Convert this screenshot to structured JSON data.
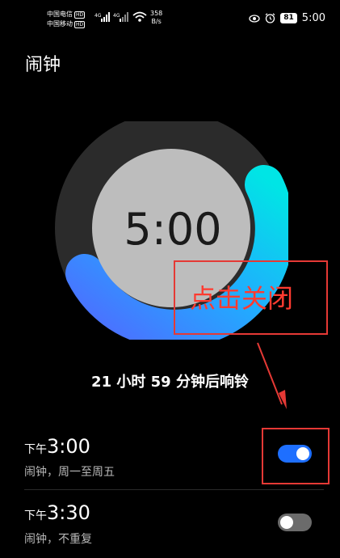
{
  "status_bar": {
    "carrier1": "中国电信",
    "carrier2": "中国移动",
    "hd_badge": "HD",
    "net_speed_value": "358",
    "net_speed_unit": "B/s",
    "battery": "81",
    "time": "5:00",
    "icons": [
      "eye-icon",
      "alarm-clock-icon",
      "wifi-icon",
      "signal-icon"
    ]
  },
  "page": {
    "title": "闹钟"
  },
  "dial": {
    "time": "5:00",
    "progress_arc_colors": [
      "#4f6bff",
      "#00d8e8"
    ]
  },
  "countdown": "21 小时 59 分钟后响铃",
  "alarms": [
    {
      "period": "下午",
      "time": "3:00",
      "subtitle": "闹钟，周一至周五",
      "enabled": true
    },
    {
      "period": "下午",
      "time": "3:30",
      "subtitle": "闹钟，不重复",
      "enabled": false
    }
  ],
  "annotation": {
    "text": "点击关闭",
    "color": "#e53935"
  },
  "colors": {
    "accent": "#1e6fff",
    "toggle_off": "#6b6b6b"
  }
}
